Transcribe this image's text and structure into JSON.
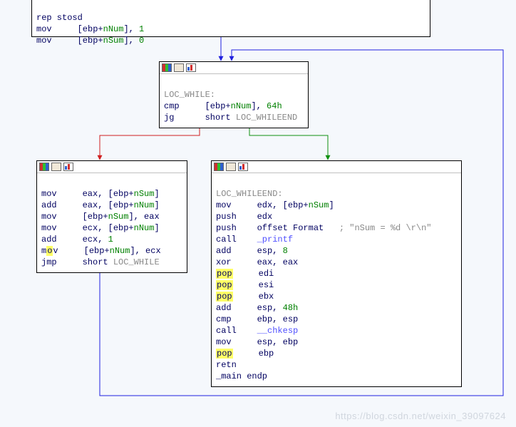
{
  "watermark": "https://blog.csdn.net/weixin_39097624",
  "icons": {
    "rgb": "rgb-icon",
    "tool": "tool-icon",
    "chart": "chart-icon"
  },
  "node1": {
    "lines": [
      {
        "op": "rep stosd"
      },
      {
        "op": "mov",
        "args": "[ebp+nNum], 1"
      },
      {
        "op": "mov",
        "args": "[ebp+nSum], 0"
      }
    ],
    "l0": "rep stosd",
    "l1a": "mov     [ebp+",
    "l1b": "nNum",
    "l1c": "], ",
    "l1d": "1",
    "l2a": "mov     [ebp+",
    "l2b": "nSum",
    "l2c": "], ",
    "l2d": "0"
  },
  "node2": {
    "label": "LOC_WHILE:",
    "l1a": "cmp     [ebp+",
    "l1b": "nNum",
    "l1c": "], ",
    "l1d": "64h",
    "l2a": "jg      ",
    "l2b": "short ",
    "l2c": "LOC_WHILEEND"
  },
  "node3": {
    "l1a": "mov     eax, [ebp+",
    "l1b": "nSum",
    "l1c": "]",
    "l2a": "add     eax, [ebp+",
    "l2b": "nNum",
    "l2c": "]",
    "l3a": "mov     [ebp+",
    "l3b": "nSum",
    "l3c": "], eax",
    "l4a": "mov     ecx, [ebp+",
    "l4b": "nNum",
    "l4c": "]",
    "l5a": "add     ecx, ",
    "l5b": "1",
    "l6a": "m",
    "l6b": "o",
    "l6c": "v     [ebp+",
    "l6d": "nNum",
    "l6e": "], ecx",
    "l7a": "jmp     ",
    "l7b": "short ",
    "l7c": "LOC_WHILE"
  },
  "node4": {
    "label": "LOC_WHILEEND:",
    "l1a": "mov     edx, [ebp+",
    "l1b": "nSum",
    "l1c": "]",
    "l2": "push    edx",
    "l3a": "push    ",
    "l3b": "offset Format",
    "l3c": "   ; ",
    "l3d": "\"nSum = %d \\r\\n\"",
    "l4a": "call    ",
    "l4b": "_printf",
    "l5a": "add     esp, ",
    "l5b": "8",
    "l6": "xor     eax, eax",
    "p1a": "pop",
    "p1b": "     edi",
    "p2a": "pop",
    "p2b": "     esi",
    "p3a": "pop",
    "p3b": "     ebx",
    "l10a": "add     esp, ",
    "l10b": "48h",
    "l11": "cmp     ebp, esp",
    "l12a": "call    ",
    "l12b": "__chkesp",
    "l13": "mov     esp, ebp",
    "p4a": "pop",
    "p4b": "     ebp",
    "l15": "retn",
    "endp": "_main endp"
  }
}
